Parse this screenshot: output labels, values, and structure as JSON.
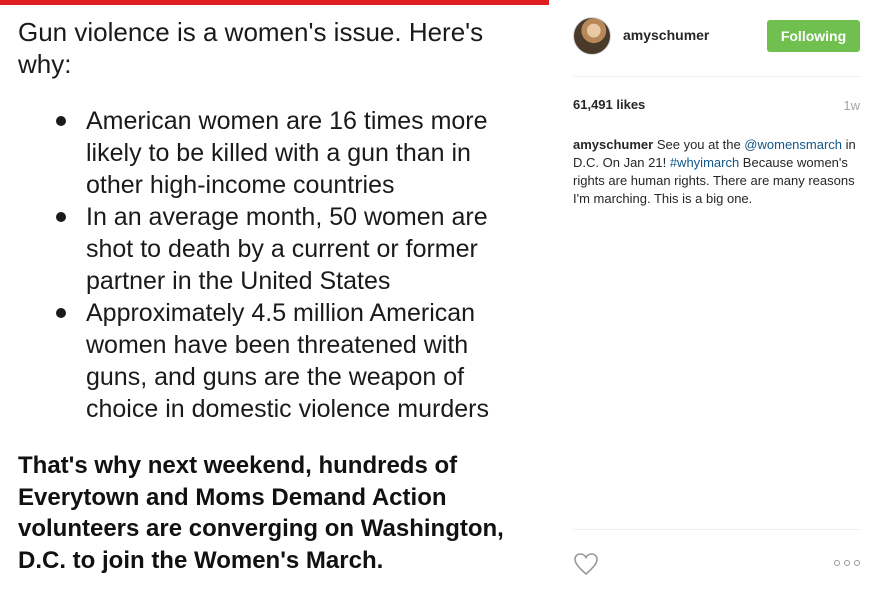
{
  "image": {
    "heading": "Gun violence is a women's issue. Here's why:",
    "bullets": [
      "American women are 16 times more likely to be killed with a gun than in other high-income countries",
      "In an average month, 50 women are shot to death by a current or former partner in the United States",
      "Approximately 4.5 million American women have been threatened with guns, and guns are the weapon of choice in domestic violence murders"
    ],
    "bold_text": "That's why next weekend, hundreds of Everytown and Moms Demand Action volunteers are converging on Washington, D.C. to join the Women's March."
  },
  "post": {
    "username": "amyschumer",
    "follow_label": "Following",
    "likes": "61,491 likes",
    "time": "1w",
    "caption": {
      "user": "amyschumer",
      "part1": " See you at the ",
      "mention": "@womensmarch",
      "part2": " in D.C. On Jan 21! ",
      "hashtag": "#whyimarch",
      "part3": " Because women's rights are human rights. There are many reasons I'm marching. This is a big one."
    }
  },
  "icons": {
    "like": "heart-icon",
    "more": "more-options-icon"
  },
  "colors": {
    "follow_button": "#70c050",
    "link": "#125688",
    "top_strip": "#e02020"
  }
}
